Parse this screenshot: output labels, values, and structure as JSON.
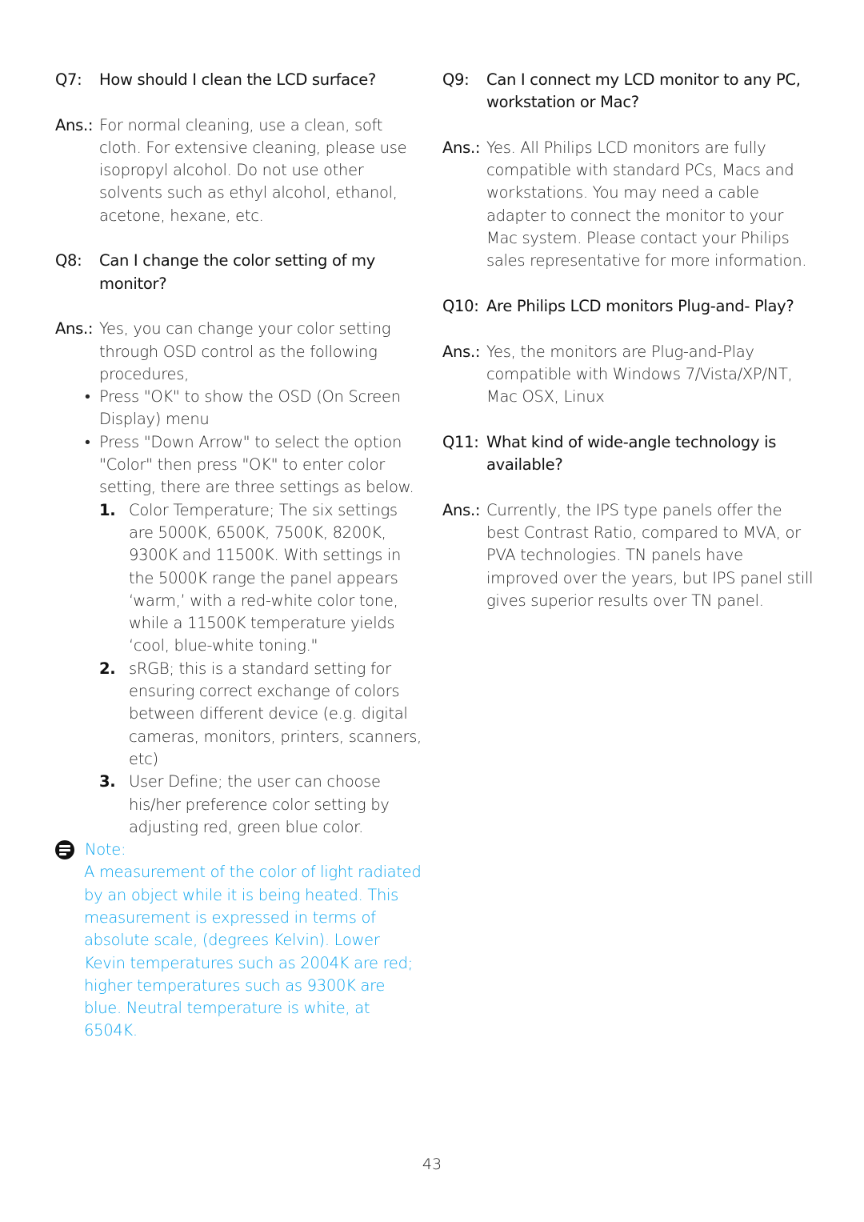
{
  "left_column": {
    "q7": {
      "label": "Q7:",
      "question": "How should I clean the LCD surface?",
      "ans_label": "Ans.:",
      "answer": "For normal cleaning, use a clean, soft cloth. For extensive cleaning, please use isopropyl alcohol. Do not use other solvents such as ethyl alcohol, ethanol, acetone, hexane, etc."
    },
    "q8": {
      "label": "Q8:",
      "question": "Can I change the color setting of my monitor?",
      "ans_label": "Ans.:",
      "answer_intro": "Yes, you can change your color setting through OSD control as the following procedures,",
      "bullets": [
        "Press \"OK\" to show the OSD (On Screen Display) menu",
        "Press \"Down Arrow\" to select the option \"Color\" then press \"OK\" to enter color setting, there are three settings as below."
      ],
      "numbered": [
        {
          "num": "1.",
          "text": "Color Temperature; The six settings are 5000K, 6500K, 7500K, 8200K, 9300K and 11500K. With settings in the 5000K range the panel appears ‘warm,’ with a red-white color tone, while a 11500K temperature yields ‘cool, blue-white toning.\""
        },
        {
          "num": "2.",
          "text": "sRGB; this is a standard setting for ensuring correct exchange of colors between different device (e.g. digital cameras, monitors, printers, scanners, etc)"
        },
        {
          "num": "3.",
          "text": "User Define; the user can choose his/her preference color setting by adjusting red, green blue color."
        }
      ]
    },
    "note": {
      "icon": "note-icon",
      "title": "Note:",
      "text": "A measurement of the color of light radiated by an object while it is being heated. This measurement is expressed in terms of absolute scale, (degrees Kelvin). Lower Kevin temperatures such as 2004K are red; higher temperatures such as 9300K are blue. Neutral temperature is white, at 6504K.",
      "color": "#0aa4ee"
    }
  },
  "right_column": {
    "q9": {
      "label": "Q9:",
      "question": "Can I connect my LCD monitor to any PC, workstation or Mac?",
      "ans_label": "Ans.:",
      "answer": "Yes. All Philips LCD monitors are fully compatible with standard PCs, Macs and workstations. You may need a cable adapter to connect the monitor to your Mac system. Please contact your Philips sales representative for more information."
    },
    "q10": {
      "label": "Q10:",
      "question": "Are Philips LCD monitors Plug-and- Play?",
      "ans_label": "Ans.:",
      "answer": "Yes, the monitors are Plug-and-Play compatible with Windows 7/Vista/XP/NT, Mac OSX, Linux"
    },
    "q11": {
      "label": "Q11:",
      "question": "What kind of wide-angle technology is available?",
      "ans_label": "Ans.:",
      "answer": "Currently, the IPS type panels offer the best Contrast Ratio, compared to MVA, or PVA technologies.  TN panels have improved over the years, but IPS panel still gives superior results over TN panel."
    }
  },
  "footer": {
    "page_number": "43"
  }
}
